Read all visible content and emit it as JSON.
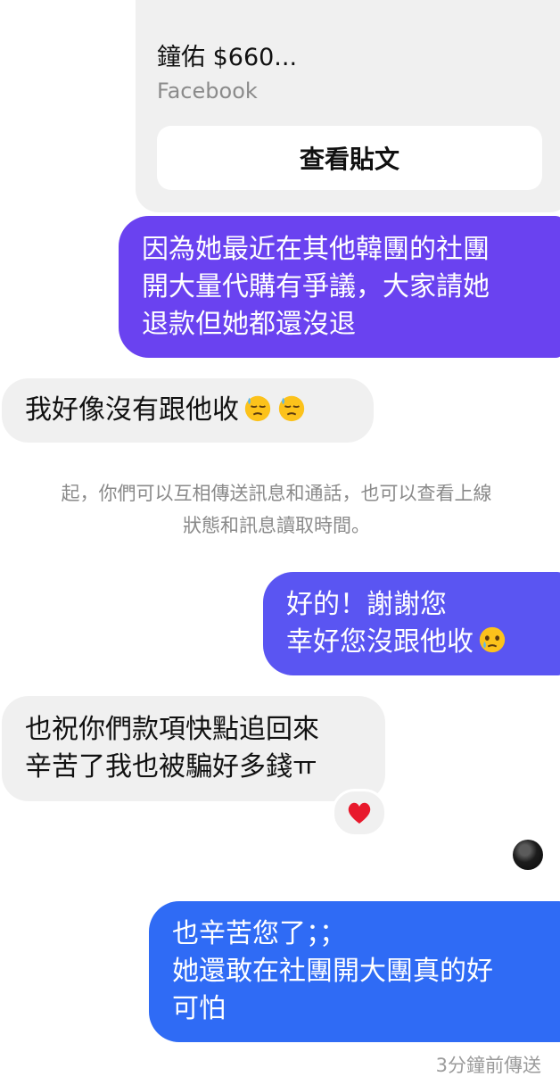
{
  "link_card": {
    "title": "鐘佑 $660...",
    "source": "Facebook",
    "button_label": "查看貼文"
  },
  "messages": [
    {
      "direction": "outgoing",
      "lines": [
        "因為她最近在其他韓團的社團",
        "開大量代購有爭議，大家請她",
        "退款但她都還沒退"
      ]
    },
    {
      "direction": "incoming",
      "lines": [
        "我好像沒有跟他收"
      ],
      "emoji": [
        "downcast-face-with-sweat",
        "downcast-face-with-sweat"
      ]
    },
    {
      "direction": "system",
      "lines": [
        "起，你們可以互相傳送訊息和通話，也可以查看上線",
        "狀態和訊息讀取時間。"
      ]
    },
    {
      "direction": "outgoing",
      "lines": [
        "好的！謝謝您",
        "幸好您沒跟他收"
      ],
      "emoji": [
        "face-holding-back-tears"
      ]
    },
    {
      "direction": "incoming",
      "lines": [
        "也祝你們款項快點追回來",
        "辛苦了我也被騙好多錢ㅠ"
      ],
      "reaction": "red-heart"
    },
    {
      "direction": "outgoing",
      "lines": [
        "也辛苦您了；；",
        "她還敢在社團開大團真的好",
        "可怕"
      ]
    }
  ],
  "status": {
    "timestamp": "3分鐘前傳送"
  },
  "colors": {
    "bubble_incoming": "#f0f0f0",
    "bubble_outgoing_1": "#6a42f0",
    "bubble_outgoing_2": "#5a55f2",
    "bubble_outgoing_3": "#2f6bf5",
    "heart": "#e8192c"
  }
}
